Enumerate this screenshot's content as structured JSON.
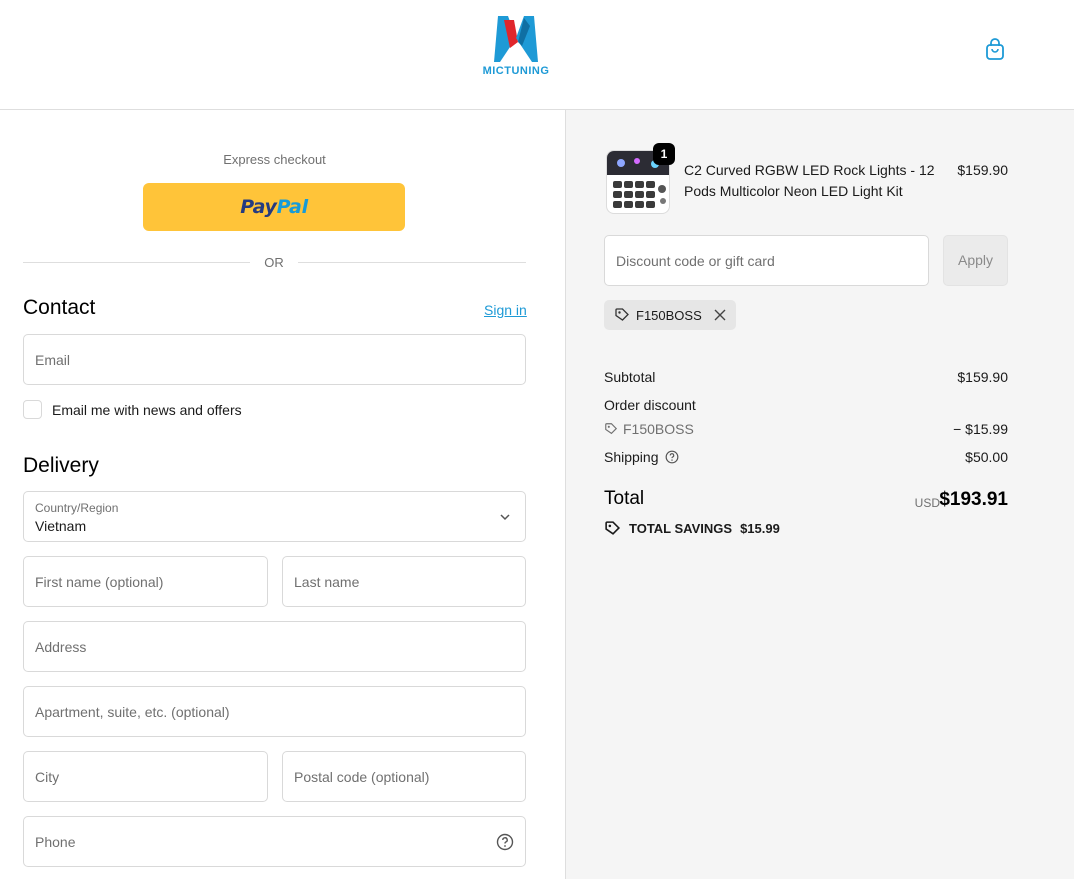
{
  "header": {
    "brand": "MICTUNING",
    "colors": {
      "brand_red": "#e0262c",
      "brand_blue": "#1e9ad6"
    }
  },
  "checkout": {
    "express_label": "Express checkout",
    "paypal": {
      "part1": "Pay",
      "part2": "Pal"
    },
    "or_label": "OR"
  },
  "contact": {
    "title": "Contact",
    "sign_in": "Sign in",
    "email_placeholder": "Email",
    "newsletter_label": "Email me with news and offers"
  },
  "delivery": {
    "title": "Delivery",
    "country_label": "Country/Region",
    "country_value": "Vietnam",
    "first_name_placeholder": "First name (optional)",
    "last_name_placeholder": "Last name",
    "address_placeholder": "Address",
    "apartment_placeholder": "Apartment, suite, etc. (optional)",
    "city_placeholder": "City",
    "postal_placeholder": "Postal code (optional)",
    "phone_placeholder": "Phone"
  },
  "summary": {
    "item": {
      "quantity": "1",
      "name": "C2 Curved RGBW LED Rock Lights - 12 Pods Multicolor Neon LED Light Kit",
      "price": "$159.90"
    },
    "discount_placeholder": "Discount code or gift card",
    "apply_label": "Apply",
    "applied_code": "F150BOSS",
    "subtotal_label": "Subtotal",
    "subtotal_value": "$159.90",
    "order_discount_label": "Order discount",
    "discount_code": "F150BOSS",
    "discount_value": "− $15.99",
    "shipping_label": "Shipping",
    "shipping_value": "$50.00",
    "total_label": "Total",
    "currency": "USD",
    "total_value": "$193.91",
    "savings_label": "TOTAL SAVINGS",
    "savings_value": "$15.99"
  }
}
